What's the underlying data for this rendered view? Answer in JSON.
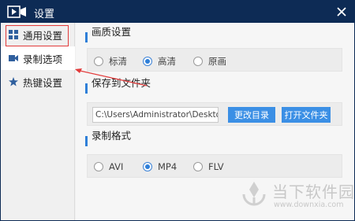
{
  "window": {
    "title": "设置",
    "accent_color": "#0d2b55",
    "highlight_color": "#e23b3b",
    "button_color": "#3b8fe5"
  },
  "sidebar": {
    "items": [
      {
        "label": "通用设置",
        "icon": "grid-icon"
      },
      {
        "label": "录制选项",
        "icon": "camera-icon",
        "selected": true
      },
      {
        "label": "热键设置",
        "icon": "star-icon"
      }
    ]
  },
  "quality": {
    "title": "画质设置",
    "options": [
      "标清",
      "高清",
      "原画"
    ],
    "selected": "高清"
  },
  "save": {
    "title": "保存到文件夹",
    "path": "C:\\Users\\Administrator\\Desktop",
    "change_label": "更改目录",
    "open_label": "打开文件夹"
  },
  "format": {
    "title": "录制格式",
    "options": [
      "AVI",
      "MP4",
      "FLV"
    ],
    "selected": "MP4"
  },
  "watermark": {
    "title": "当下软件园",
    "url": "www.downxia.com"
  }
}
